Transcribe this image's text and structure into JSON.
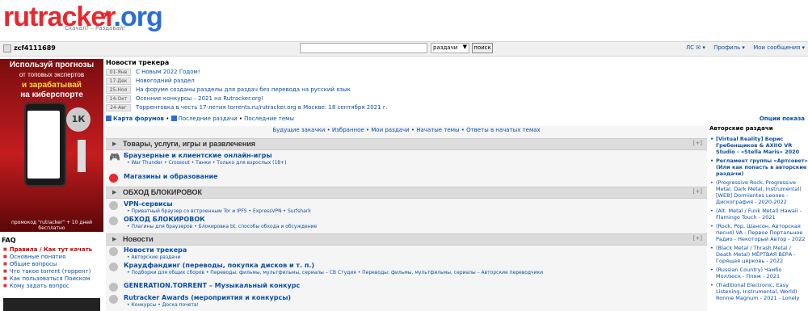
{
  "header": {
    "logo_part1": "ru",
    "logo_part2": "tracker",
    "logo_part3": ".org",
    "tagline": "Скачал? – Раздавай!"
  },
  "topbar": {
    "username": "zcf4111689",
    "search_value": "",
    "search_scope": "раздачи",
    "search_button": "поиск",
    "links": [
      "ЛС ✉ ▾",
      "Профиль ▾",
      "Мои сообщения ▾"
    ]
  },
  "ad": {
    "line1": "Используй прогнозы",
    "line2": "от топовых экспертов",
    "line3": "и зарабатывай",
    "line4": "на киберспорте",
    "coin": "1К",
    "promo": "промокод \"rutracker\" + 10 дней бесплатно"
  },
  "faq": {
    "title": "FAQ",
    "items": [
      "Правила / Как тут качать",
      "Основные понятия",
      "Общие вопросы",
      "Что такое torrent (торрент)",
      "Как пользоваться Поиском",
      "Кому задать вопрос"
    ]
  },
  "news": {
    "title": "Новости трекера",
    "items": [
      {
        "date": "01-Янв",
        "text": "С Новым 2022 Годом!"
      },
      {
        "date": "17-Дек",
        "text": "Новогодний раздел"
      },
      {
        "date": "25-Ноя",
        "text": "На форуме созданы разделы для раздач без перевода на русский язык"
      },
      {
        "date": "14-Окт",
        "text": "Осенние конкурсы – 2021 на Rutracker.org!"
      },
      {
        "date": "24-Авг",
        "text": "Торрентовка в честь 17-летия torrents.ru/rutracker.org в Москве. 18 сентября 2021 г."
      }
    ],
    "map": "Карта форумов",
    "recent": "Последние раздачи",
    "recent_topics": "Последние темы",
    "options": "Опции показа"
  },
  "forum": {
    "quick_links": "Будущие закачки • Избранное • Мои раздачи • Начатые темы • Ответы в начатых темах",
    "cat1": "Товары, услуги, игры и развлечения",
    "f1_title": "Браузерные и клиентские онлайн-игры",
    "f1_sub": "• War Thunder • Crossout • Танки • Только для взрослых (18+)",
    "f2_title": "Магазины и образование",
    "cat2": "ОБХОД БЛОКИРОВОК",
    "f3_title": "VPN-сервисы",
    "f3_sub": "• Приватный браузер со встроенным Tor и IPFS • ExpressVPN • Surfshark",
    "f4_title": "ОБХОД БЛОКИРОВОК",
    "f4_sub": "• Плагины для браузеров • Блокировка bt, способы обхода и обсуждение",
    "cat3": "Новости",
    "f5_title": "Новости трекера",
    "f5_sub": "• Авторские раздачи",
    "f6_title": "Краудфандинг (переводы, покупка дисков и т. п.)",
    "f6_sub": "• Подборки для общих сборов • Переводы: фильмы, мультфильмы, сериалы – СВ Студия • Переводы: фильмы, мультфильмы, сериалы – Авторские переводчики",
    "f7_title": "GENERATION.TORRENT – Музыкальный конкурс",
    "f8_title": "Rutracker Awards (мероприятия и конкурсы)",
    "f8_sub": "• Конкурсы • Доска почета!",
    "plus": "[+]"
  },
  "right": {
    "title": "Авторские раздачи",
    "items": [
      "[Virtual Reality] Борис Гребенщиков & AXIIO VR Studio - «Stella Maris» 2020",
      "Регламент группы «Артсовет» (Или как попасть в авторские раздачи)",
      "(Progressive Rock, Progressive Metal, Dark Metal, Instrumental) [WEB] Dormientes Leones - Дискография - 2020-2022",
      "(Alt. Metal / Funk Metal) Hawaii - Flamingo Touch - 2021",
      "(Rock, Pop, Шансон, Авторская песня) VA - Первое Портальное Радио - Некоторый Автор - 2022",
      "(Black Metal / Thrash Metal / Death Metal) МЁРТВАЯ ВЕРА - Горящая церковь - 2022",
      "(Russian Country) Чамбо Моллюск - Пляж - 2021",
      "(Traditional Electronic, Easy Listening, Instrumental, World) Ronnie Magnum - 2021 - Lonely"
    ]
  }
}
